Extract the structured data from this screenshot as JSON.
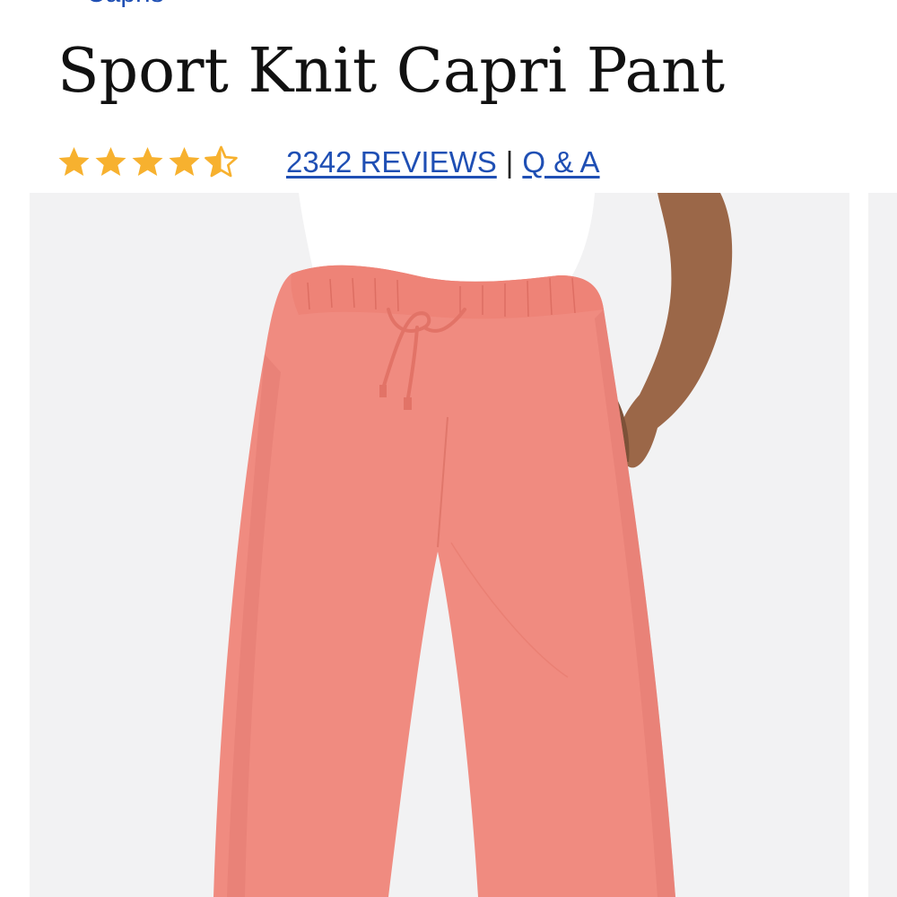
{
  "breadcrumb": {
    "label": "Capris",
    "icon": "chevron-down-icon"
  },
  "product": {
    "title": "Sport Knit Capri Pant",
    "rating": 4.5,
    "rating_max": 5,
    "reviews_label": "2342 REVIEWS",
    "separator": "|",
    "qa_label": "Q & A"
  },
  "colors": {
    "link": "#1f4fb4",
    "star": "#f7b12f",
    "pant": "#f08b80",
    "photo_bg": "#f2f2f3"
  },
  "gallery": {
    "main_image": "coral-capri-pants-photo",
    "has_next_image": true
  }
}
